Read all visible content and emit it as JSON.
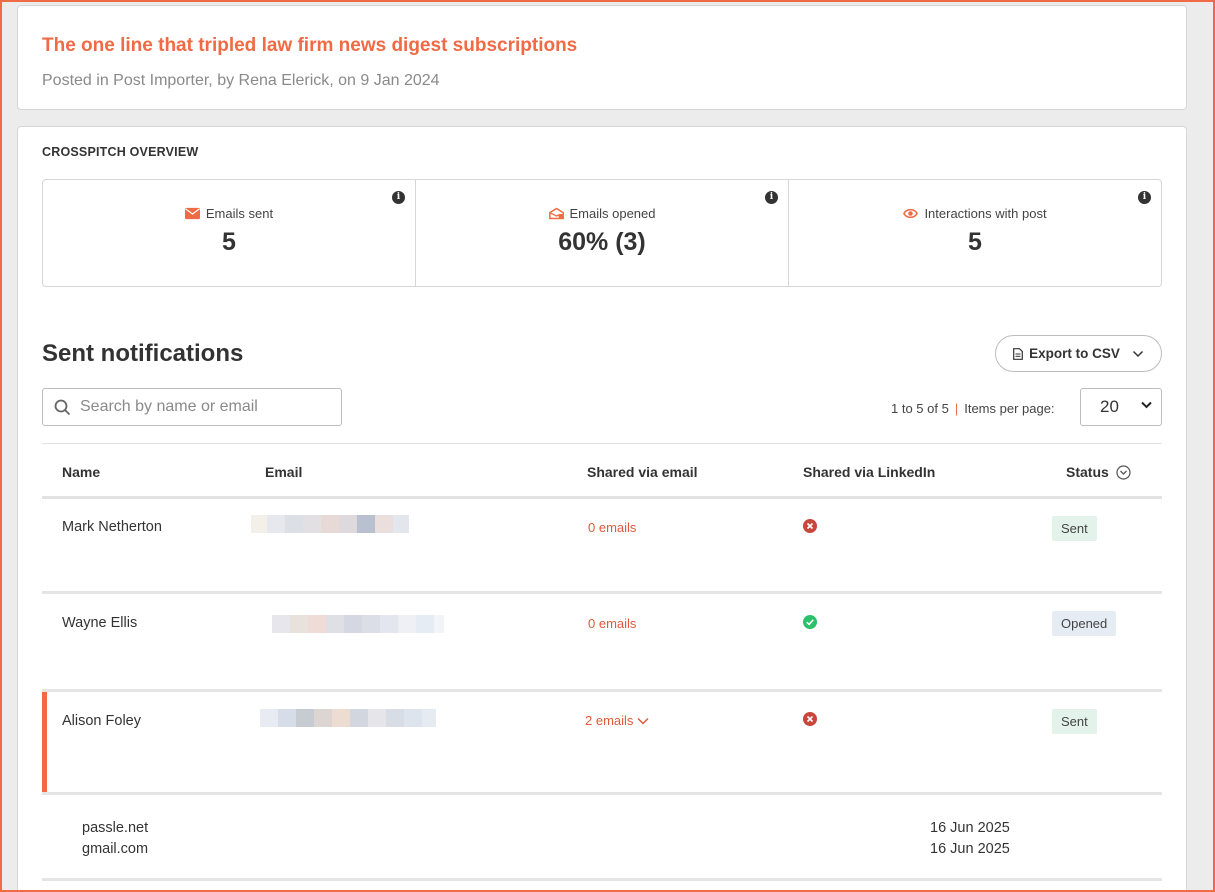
{
  "post": {
    "title": "The one line that tripled law firm news digest subscriptions",
    "meta": "Posted in Post Importer, by Rena Elerick, on 9 Jan 2024"
  },
  "overview": {
    "heading": "CROSSPITCH OVERVIEW",
    "stats": [
      {
        "label": "Emails sent",
        "value": "5",
        "icon": "envelope-icon"
      },
      {
        "label": "Emails opened",
        "value": "60% (3)",
        "icon": "envelope-open-icon"
      },
      {
        "label": "Interactions with post",
        "value": "5",
        "icon": "eye-icon"
      }
    ]
  },
  "notifications": {
    "title": "Sent notifications",
    "export_label": "Export to CSV",
    "search_placeholder": "Search by name or email",
    "pager_range": "1 to 5 of 5",
    "pager_sep": "|",
    "items_per_page_label": "Items per page:",
    "items_per_page_value": "20",
    "columns": {
      "name": "Name",
      "email": "Email",
      "shared_email": "Shared via email",
      "shared_linkedin": "Shared via LinkedIn",
      "status": "Status"
    },
    "rows": [
      {
        "name": "Mark Netherton",
        "shared_email": "0 emails",
        "linkedin": "no",
        "status": "Sent"
      },
      {
        "name": "Wayne Ellis",
        "shared_email": "0 emails",
        "linkedin": "yes",
        "status": "Opened"
      },
      {
        "name": "Alison Foley",
        "shared_email": "2 emails",
        "linkedin": "no",
        "status": "Sent"
      }
    ],
    "expanded_details": [
      {
        "domain": "passle.net",
        "date": "16 Jun 2025"
      },
      {
        "domain": "gmail.com",
        "date": "16 Jun 2025"
      }
    ]
  },
  "colors": {
    "accent": "#f06a45",
    "success": "#2ebf6b",
    "danger": "#c9463d",
    "badge_sent": "#e3f2ea",
    "badge_opened": "#e5ecf3"
  }
}
